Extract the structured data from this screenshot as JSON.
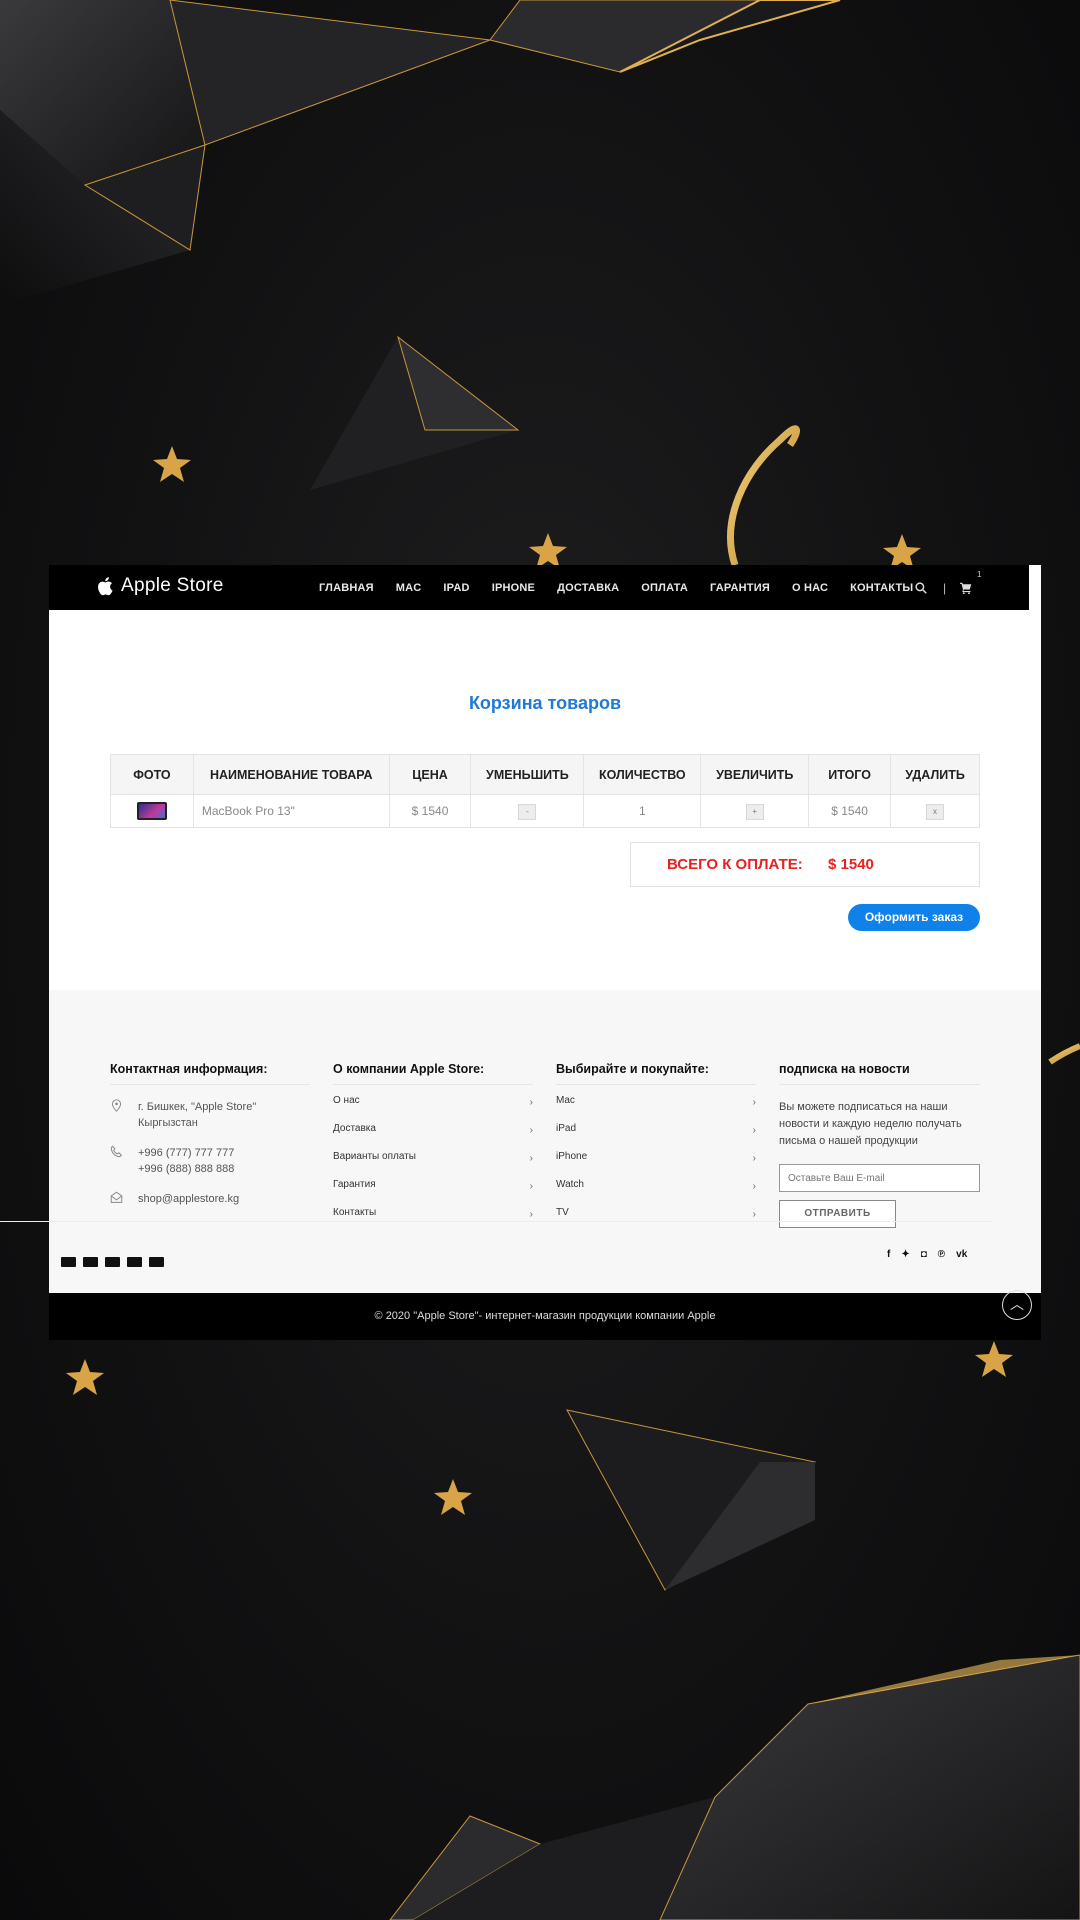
{
  "brand": {
    "name": "Apple Store"
  },
  "nav": {
    "items": [
      "ГЛАВНАЯ",
      "MAC",
      "IPAD",
      "IPHONE",
      "ДОСТАВКА",
      "ОПЛАТА",
      "ГАРАНТИЯ",
      "О НАС",
      "КОНТАКТЫ"
    ],
    "cart_count": "1",
    "separator": "|"
  },
  "cart": {
    "title": "Корзина товаров",
    "columns": [
      "ФОТО",
      "НАИМЕНОВАНИЕ ТОВАРА",
      "ЦЕНА",
      "УМЕНЬШИТЬ",
      "КОЛИЧЕСТВО",
      "УВЕЛИЧИТЬ",
      "ИТОГО",
      "УДАЛИТЬ"
    ],
    "row": {
      "name": "MacBook Pro 13\"",
      "price": "$ 1540",
      "decrease": "-",
      "quantity": "1",
      "increase": "+",
      "total": "$ 1540",
      "remove": "x"
    },
    "total_label": "ВСЕГО К ОПЛАТЕ:",
    "total_value": "$ 1540",
    "order_button": "Оформить заказ"
  },
  "footer": {
    "contact": {
      "title": "Контактная информация:",
      "address": "г. Бишкек, \"Apple Store\" Кыргызстан",
      "phone1": "+996 (777) 777 777",
      "phone2": "+996 (888) 888 888",
      "email": "shop@applestore.kg"
    },
    "about": {
      "title": "О компании Apple Store:",
      "links": [
        "О нас",
        "Доставка",
        "Варианты оплаты",
        "Гарантия",
        "Контакты"
      ]
    },
    "shop": {
      "title": "Выбирайте и покупайте:",
      "links": [
        "Mac",
        "iPad",
        "iPhone",
        "Watch",
        "TV"
      ]
    },
    "subscribe": {
      "title": "подписка на новости",
      "text": "Вы можете подписаться на наши новости и каждую неделю получать письма о нашей продукции",
      "placeholder": "Оставьте Ваш E-mail",
      "button": "ОТПРАВИТЬ"
    },
    "copyright": "© 2020 \"Apple Store\"- интернет-магазин продукции компании Apple"
  }
}
